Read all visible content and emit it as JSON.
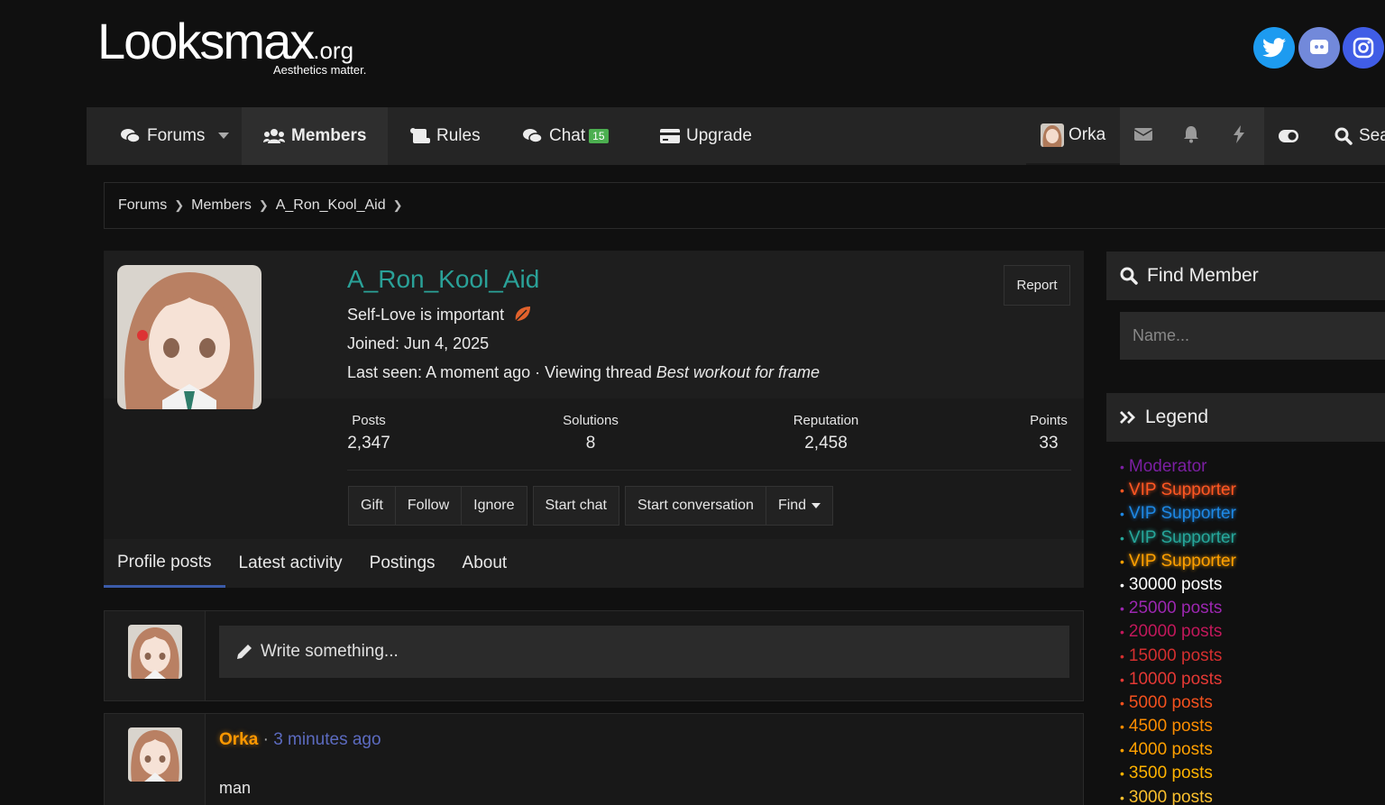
{
  "header": {
    "logo_text": "Looksmax",
    "logo_suffix": ".org",
    "tagline": "Aesthetics matter."
  },
  "nav": {
    "forums": "Forums",
    "members": "Members",
    "rules": "Rules",
    "chat": "Chat",
    "chat_badge": "15",
    "upgrade": "Upgrade",
    "user": "Orka",
    "search": "Sea"
  },
  "breadcrumb": [
    "Forums",
    "Members",
    "A_Ron_Kool_Aid"
  ],
  "profile": {
    "username": "A_Ron_Kool_Aid",
    "custom_title": "Self-Love is important",
    "joined": "Joined: Jun 4, 2025",
    "last_seen_prefix": "Last seen: A moment ago · Viewing thread",
    "last_seen_thread": "Best workout for frame",
    "report": "Report",
    "stats": [
      {
        "label": "Posts",
        "value": "2,347"
      },
      {
        "label": "Solutions",
        "value": "8"
      },
      {
        "label": "Reputation",
        "value": "2,458"
      },
      {
        "label": "Points",
        "value": "33"
      }
    ],
    "actions_group1": [
      "Gift",
      "Follow",
      "Ignore"
    ],
    "actions_group2": [
      "Start chat"
    ],
    "actions_group3": [
      "Start conversation",
      "Find"
    ],
    "tabs": [
      "Profile posts",
      "Latest activity",
      "Postings",
      "About"
    ]
  },
  "composer": {
    "placeholder": "Write something..."
  },
  "post": {
    "author": "Orka",
    "sep": "·",
    "time": "3 minutes ago",
    "body": "man"
  },
  "sidebar": {
    "find_member_title": "Find Member",
    "name_placeholder": "Name...",
    "legend_title": "Legend",
    "legend": [
      {
        "label": "Moderator",
        "color": "#7b1fa2"
      },
      {
        "label": "VIP Supporter",
        "color": "#ff5722"
      },
      {
        "label": "VIP Supporter",
        "color": "#1e88e5"
      },
      {
        "label": "VIP Supporter",
        "color": "#26a69a"
      },
      {
        "label": "VIP Supporter",
        "color": "#ffa000"
      },
      {
        "label": "30000 posts",
        "color": "#ffffff"
      },
      {
        "label": "25000 posts",
        "color": "#9c27b0"
      },
      {
        "label": "20000 posts",
        "color": "#c2185b"
      },
      {
        "label": "15000 posts",
        "color": "#d32f2f"
      },
      {
        "label": "10000 posts",
        "color": "#e53935"
      },
      {
        "label": "5000 posts",
        "color": "#f4511e"
      },
      {
        "label": "4500 posts",
        "color": "#fb8c00"
      },
      {
        "label": "4000 posts",
        "color": "#ffa000"
      },
      {
        "label": "3500 posts",
        "color": "#ffb300"
      },
      {
        "label": "3000 posts",
        "color": "#fbc02d"
      }
    ]
  }
}
